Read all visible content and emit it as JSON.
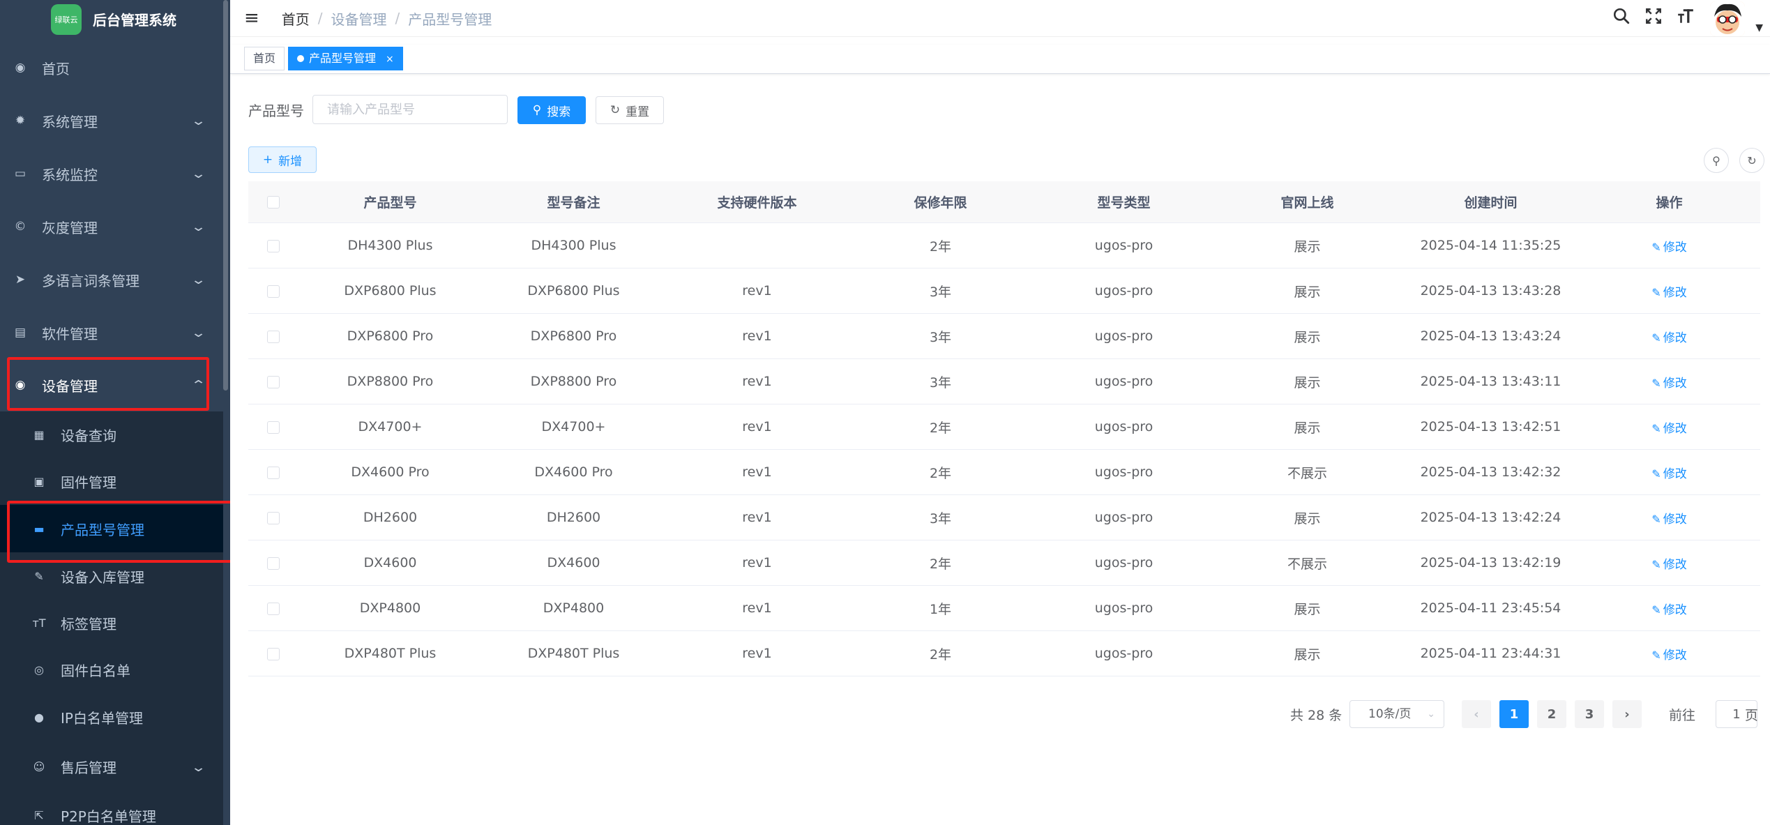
{
  "app": {
    "logo_text": "后台管理系统",
    "logo_badge": "绿联云"
  },
  "sidebar": {
    "items": [
      {
        "label": "首页",
        "icon": "dashboard-icon"
      },
      {
        "label": "系统管理",
        "icon": "gear-icon"
      },
      {
        "label": "系统监控",
        "icon": "monitor-icon"
      },
      {
        "label": "灰度管理",
        "icon": "gray-release-icon"
      },
      {
        "label": "多语言词条管理",
        "icon": "send-icon"
      },
      {
        "label": "软件管理",
        "icon": "software-icon"
      },
      {
        "label": "设备管理",
        "icon": "device-icon"
      }
    ],
    "sub_items": [
      {
        "label": "设备查询",
        "icon": "table-icon"
      },
      {
        "label": "固件管理",
        "icon": "chip-icon"
      },
      {
        "label": "产品型号管理",
        "icon": "model-icon"
      },
      {
        "label": "设备入库管理",
        "icon": "edit-icon"
      },
      {
        "label": "标签管理",
        "icon": "font-size-icon"
      },
      {
        "label": "固件白名单",
        "icon": "eye-icon"
      },
      {
        "label": "IP白名单管理",
        "icon": "globe-icon"
      }
    ],
    "after_items": [
      {
        "label": "售后管理",
        "icon": "service-icon"
      },
      {
        "label": "P2P白名单管理",
        "icon": "external-link-icon"
      }
    ]
  },
  "header": {
    "breadcrumb": [
      "首页",
      "设备管理",
      "产品型号管理"
    ]
  },
  "tags": {
    "home": "首页",
    "active": "产品型号管理"
  },
  "search": {
    "label": "产品型号",
    "placeholder": "请输入产品型号",
    "search_button": "搜索",
    "reset_button": "重置"
  },
  "toolbar": {
    "add_button": "新增"
  },
  "table": {
    "columns": [
      "产品型号",
      "型号备注",
      "支持硬件版本",
      "保修年限",
      "型号类型",
      "官网上线",
      "创建时间",
      "操作"
    ],
    "action_label": "修改",
    "rows": [
      [
        "DH4300 Plus",
        "DH4300 Plus",
        "",
        "2年",
        "ugos-pro",
        "展示",
        "2025-04-14 11:35:25"
      ],
      [
        "DXP6800 Plus",
        "DXP6800 Plus",
        "rev1",
        "3年",
        "ugos-pro",
        "展示",
        "2025-04-13 13:43:28"
      ],
      [
        "DXP6800 Pro",
        "DXP6800 Pro",
        "rev1",
        "3年",
        "ugos-pro",
        "展示",
        "2025-04-13 13:43:24"
      ],
      [
        "DXP8800 Pro",
        "DXP8800 Pro",
        "rev1",
        "3年",
        "ugos-pro",
        "展示",
        "2025-04-13 13:43:11"
      ],
      [
        "DX4700+",
        "DX4700+",
        "rev1",
        "2年",
        "ugos-pro",
        "展示",
        "2025-04-13 13:42:51"
      ],
      [
        "DX4600 Pro",
        "DX4600 Pro",
        "rev1",
        "2年",
        "ugos-pro",
        "不展示",
        "2025-04-13 13:42:32"
      ],
      [
        "DH2600",
        "DH2600",
        "rev1",
        "3年",
        "ugos-pro",
        "展示",
        "2025-04-13 13:42:24"
      ],
      [
        "DX4600",
        "DX4600",
        "rev1",
        "2年",
        "ugos-pro",
        "不展示",
        "2025-04-13 13:42:19"
      ],
      [
        "DXP4800",
        "DXP4800",
        "rev1",
        "1年",
        "ugos-pro",
        "展示",
        "2025-04-11 23:45:54"
      ],
      [
        "DXP480T Plus",
        "DXP480T Plus",
        "rev1",
        "2年",
        "ugos-pro",
        "展示",
        "2025-04-11 23:44:31"
      ]
    ]
  },
  "pagination": {
    "total": "共 28 条",
    "page_size": "10条/页",
    "pages": [
      "1",
      "2",
      "3"
    ],
    "current": "1",
    "goto_prefix": "前往",
    "goto_value": "1",
    "goto_suffix": "页"
  },
  "colors": {
    "primary": "#1890ff",
    "sidebar_bg": "#304156",
    "submenu_bg": "#1f2d3d",
    "highlight_box": "#f01e1e"
  }
}
